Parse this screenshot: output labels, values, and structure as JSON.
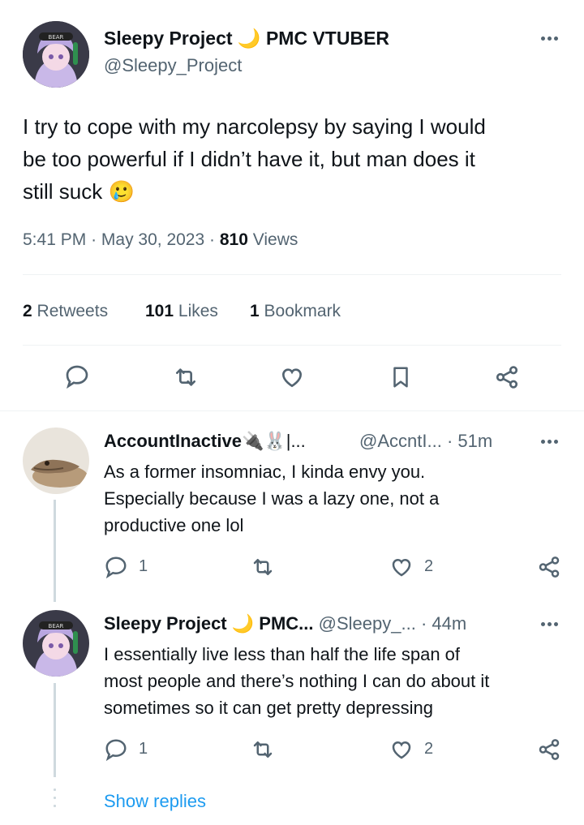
{
  "main_tweet": {
    "display_name": "Sleepy Project",
    "moon": "🌙",
    "badge": "PMC VTUBER",
    "handle": "@Sleepy_Project",
    "text_lines": [
      "I try to cope with my narcolepsy by saying I would",
      "be too powerful if I didn’t have it, but man does it",
      "still suck"
    ],
    "emoji": "🥲",
    "time": "5:41 PM",
    "date": "May 30, 2023",
    "views_count": "810",
    "views_label": "Views",
    "sep": "·",
    "retweets_count": "2",
    "retweets_label": "Retweets",
    "likes_count": "101",
    "likes_label": "Likes",
    "bookmarks_count": "1",
    "bookmarks_label": "Bookmark"
  },
  "replies": [
    {
      "display_name": "AccountInactive",
      "name_suffix": "🔌🐰|...",
      "handle": "@AccntI...",
      "sep": "·",
      "time": "51m",
      "text_lines": [
        "As a former insomniac, I kinda envy you.",
        "Especially because I was a lazy one, not a",
        "productive one lol"
      ],
      "reply_count": "1",
      "like_count": "2"
    },
    {
      "display_name": "Sleepy Project",
      "moon": "🌙",
      "badge": "PMC...",
      "handle": "@Sleepy_...",
      "sep": "·",
      "time": "44m",
      "text_lines": [
        "I essentially live less than half the life span of",
        "most people and there’s nothing I can do about it",
        "sometimes so it can get pretty depressing"
      ],
      "reply_count": "1",
      "like_count": "2"
    }
  ],
  "show_replies": "Show replies",
  "colors": {
    "text": "#0f1419",
    "secondary": "#536471",
    "link": "#1d9bf0",
    "divider": "#eff3f4"
  },
  "icons": [
    "reply-icon",
    "retweet-icon",
    "like-icon",
    "bookmark-icon",
    "share-icon",
    "more-icon"
  ]
}
